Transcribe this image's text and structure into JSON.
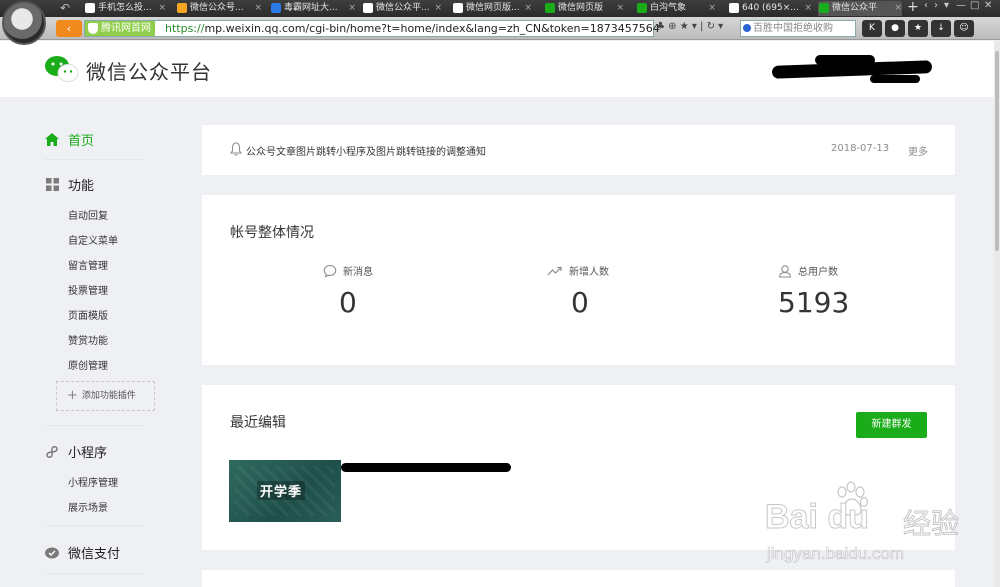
{
  "browser": {
    "tabs": [
      {
        "title": "手机怎么投...",
        "favicon_color": "#ffffff"
      },
      {
        "title": "微信公众号...",
        "favicon_color": "#f5a623"
      },
      {
        "title": "毒霸网址大...",
        "favicon_color": "#2a7be4"
      },
      {
        "title": "微信公众平...",
        "favicon_color": "#ffffff"
      },
      {
        "title": "微信网页版...",
        "favicon_color": "#ffffff"
      },
      {
        "title": "微信网页版",
        "favicon_color": "#1aad19"
      },
      {
        "title": "白沟气象",
        "favicon_color": "#1aad19"
      },
      {
        "title": "640 (695×...",
        "favicon_color": "#ffffff"
      },
      {
        "title": "微信公众平",
        "favicon_color": "#1aad19"
      }
    ],
    "site_badge": "腾讯网首网",
    "url_protocol": "https://",
    "url_rest": "mp.weixin.qq.com/cgi-bin/home?t=home/index&lang=zh_CN&token=1873457564",
    "search_placeholder": "百胜中国拒绝收购",
    "back_icon": "↶",
    "close_glyph": "×",
    "plus_glyph": "+",
    "tab_ctrl_glyphs": [
      "‹",
      "›",
      "▾",
      "—",
      "□",
      "✕"
    ],
    "url_tool_glyphs": "♣ ⊕ ★ ▾ | ↻ ▾",
    "toolbar_btn_glyphs": [
      "K",
      "●",
      "★",
      "↓",
      "☺"
    ]
  },
  "header": {
    "app_name": "微信公众平台"
  },
  "sidebar": {
    "home": "首页",
    "function_group": "功能",
    "function_items": [
      "自动回复",
      "自定义菜单",
      "留言管理",
      "投票管理",
      "页面模版",
      "赞赏功能",
      "原创管理"
    ],
    "add_plugin": "添加功能插件",
    "miniprogram_group": "小程序",
    "miniprogram_items": [
      "小程序管理",
      "展示场景"
    ],
    "pay_group": "微信支付"
  },
  "notice": {
    "text": "公众号文章图片跳转小程序及图片跳转链接的调整通知",
    "date": "2018-07-13",
    "more": "更多"
  },
  "overview": {
    "title": "帐号整体情况",
    "stats": [
      {
        "label": "新消息",
        "value": "0",
        "icon": "message-icon"
      },
      {
        "label": "新增人数",
        "value": "0",
        "icon": "trend-icon"
      },
      {
        "label": "总用户数",
        "value": "5193",
        "icon": "user-icon"
      }
    ]
  },
  "recent": {
    "title": "最近编辑",
    "new_button": "新建群发",
    "article_thumb_text": "开学季"
  },
  "watermark": {
    "brand": "Bai du",
    "brand_cn": "经验",
    "url": "jingyan.baidu.com"
  },
  "colors": {
    "accent_green": "#1aad19",
    "page_bg": "#eef0f3"
  }
}
